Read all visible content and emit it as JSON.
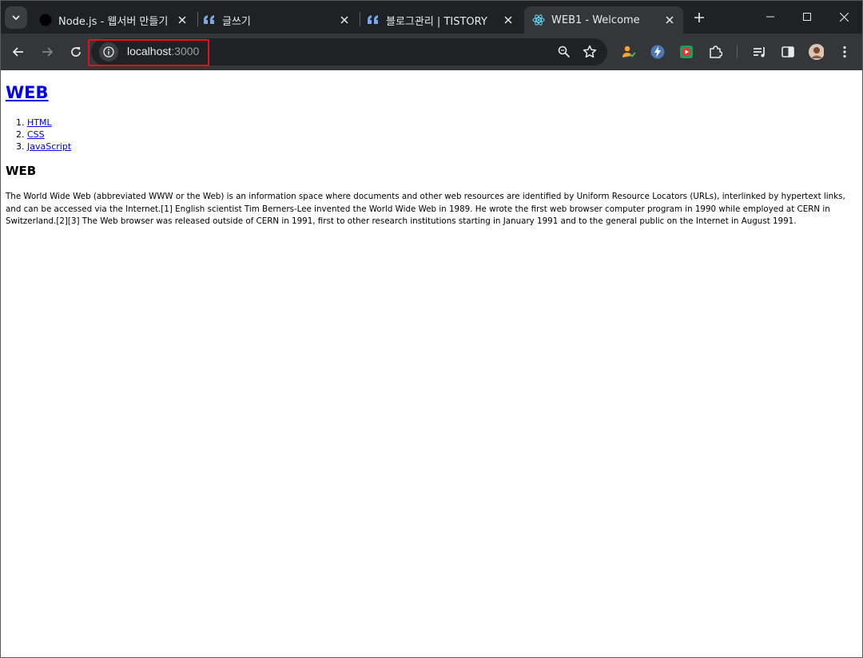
{
  "browser": {
    "tabs": [
      {
        "title": "Node.js - 웹서버 만들기",
        "favicon": "black-circle-icon",
        "active": false
      },
      {
        "title": "글쓰기",
        "favicon": "tistory-quote-icon",
        "active": false
      },
      {
        "title": "블로그관리 | TISTORY",
        "favicon": "tistory-quote-icon",
        "active": false
      },
      {
        "title": "WEB1 - Welcome",
        "favicon": "react-icon",
        "active": true
      }
    ],
    "address": {
      "host": "localhost",
      "port": ":3000"
    },
    "colors": {
      "frame": "#202124",
      "toolbar": "#35363a",
      "highlight": "#e3101d"
    }
  },
  "page": {
    "heading": "WEB",
    "nav": [
      {
        "label": "HTML"
      },
      {
        "label": "CSS"
      },
      {
        "label": "JavaScript"
      }
    ],
    "section_title": "WEB",
    "body": "The World Wide Web (abbreviated WWW or the Web) is an information space where documents and other web resources are identified by Uniform Resource Locators (URLs), interlinked by hypertext links, and can be accessed via the Internet.[1] English scientist Tim Berners-Lee invented the World Wide Web in 1989. He wrote the first web browser computer program in 1990 while employed at CERN in Switzerland.[2][3] The Web browser was released outside of CERN in 1991, first to other research institutions starting in January 1991 and to the general public on the Internet in August 1991."
  }
}
